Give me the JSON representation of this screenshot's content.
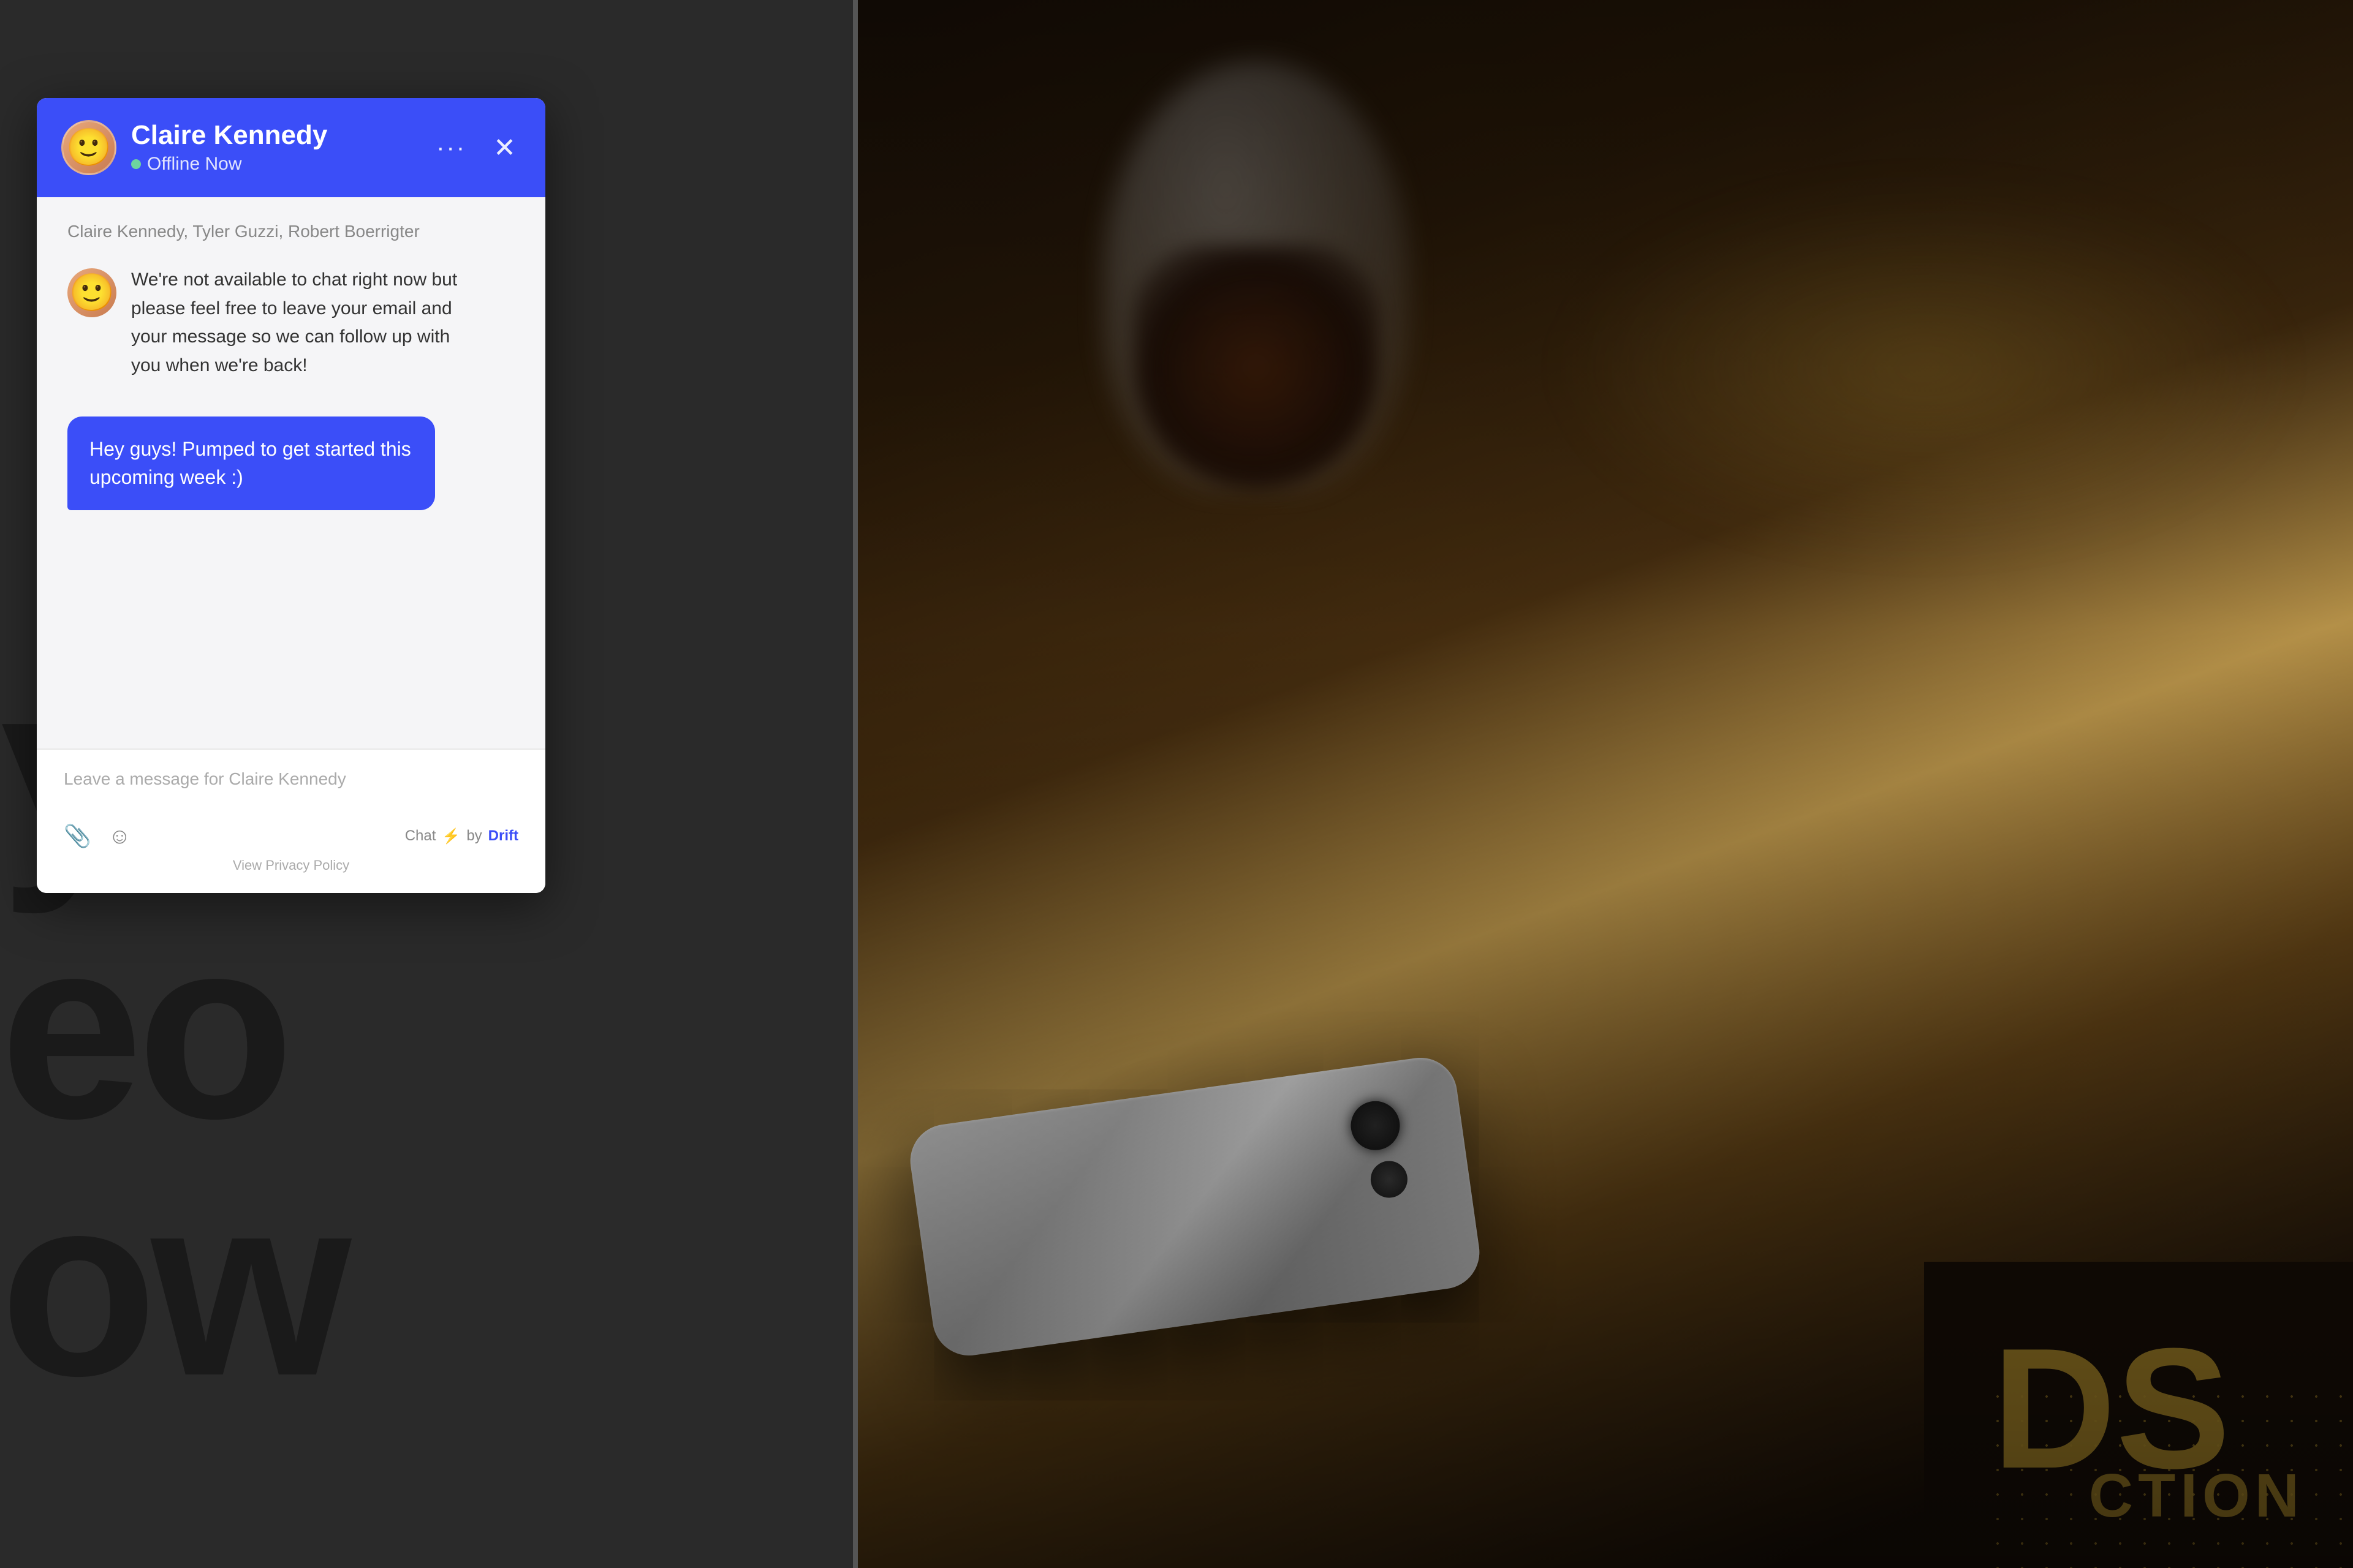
{
  "header": {
    "name": "Claire Kennedy",
    "status": "Offline Now",
    "dots_label": "···",
    "close_label": "✕"
  },
  "chat": {
    "participants": "Claire Kennedy, Tyler Guzzi, Robert Boerrigter",
    "bot_message": "We're not available to chat right now but please feel free to leave your email and your message so we can follow up with you when we're back!",
    "user_message": "Hey guys! Pumped to get started this upcoming week :)",
    "input_placeholder": "Leave a message for Claire Kennedy",
    "chat_label": "Chat",
    "by_label": "by",
    "drift_label": "Drift",
    "privacy_label": "View Privacy Policy"
  },
  "background": {
    "letters": "yo\neo\now"
  }
}
